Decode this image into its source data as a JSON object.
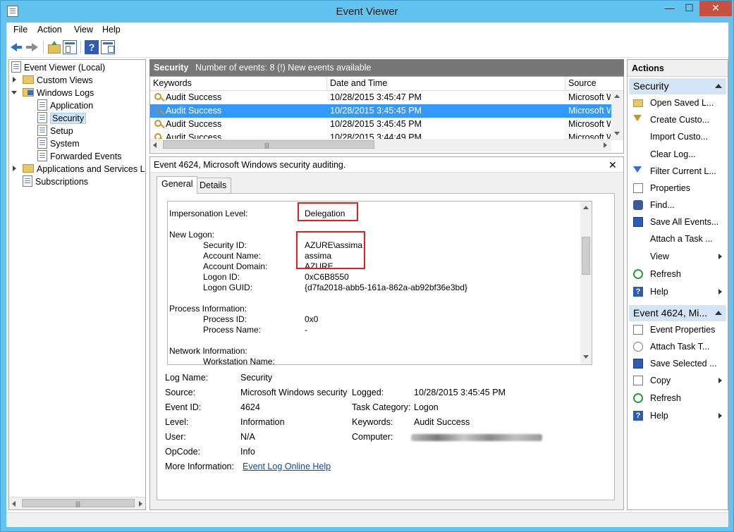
{
  "window": {
    "title": "Event Viewer"
  },
  "menu": {
    "file": "File",
    "action": "Action",
    "view": "View",
    "help": "Help"
  },
  "toolbar": {
    "help_glyph": "?"
  },
  "tree": {
    "root": "Event Viewer (Local)",
    "custom_views": "Custom Views",
    "windows_logs": "Windows Logs",
    "application": "Application",
    "security": "Security",
    "setup": "Setup",
    "system": "System",
    "forwarded_events": "Forwarded Events",
    "apps_services": "Applications and Services Lo",
    "subscriptions": "Subscriptions"
  },
  "list_header": {
    "title": "Security",
    "info": "Number of events: 8 (!) New events available"
  },
  "columns": {
    "keywords": "Keywords",
    "datetime": "Date and Time",
    "source": "Source"
  },
  "events": [
    {
      "keywords": "Audit Success",
      "datetime": "10/28/2015 3:45:47 PM",
      "source": "Microsoft W"
    },
    {
      "keywords": "Audit Success",
      "datetime": "10/28/2015 3:45:45 PM",
      "source": "Microsoft W"
    },
    {
      "keywords": "Audit Success",
      "datetime": "10/28/2015 3:45:45 PM",
      "source": "Microsoft W"
    },
    {
      "keywords": "Audit Success",
      "datetime": "10/28/2015 3:44:49 PM",
      "source": "Microsoft W"
    }
  ],
  "detail": {
    "title": "Event 4624, Microsoft Windows security auditing.",
    "close_glyph": "✕",
    "tab_general": "General",
    "tab_details": "Details",
    "message": {
      "impersonation_label": "Impersonation Level:",
      "impersonation_value": "Delegation",
      "new_logon": "New Logon:",
      "security_id_label": "Security ID:",
      "security_id_value": "AZURE\\assima",
      "account_name_label": "Account Name:",
      "account_name_value": "assima",
      "account_domain_label": "Account Domain:",
      "account_domain_value": "AZURE",
      "logon_id_label": "Logon ID:",
      "logon_id_value": "0xC6B8550",
      "logon_guid_label": "Logon GUID:",
      "logon_guid_value": "{d7fa2018-abb5-161a-862a-ab92bf36e3bd}",
      "process_info": "Process Information:",
      "process_id_label": "Process ID:",
      "process_id_value": "0x0",
      "process_name_label": "Process Name:",
      "process_name_value": "-",
      "network_info": "Network Information:",
      "workstation_label": "Workstation Name:"
    },
    "props": {
      "log_name_label": "Log Name:",
      "log_name_value": "Security",
      "source_label": "Source:",
      "source_value": "Microsoft Windows security",
      "logged_label": "Logged:",
      "logged_value": "10/28/2015 3:45:45 PM",
      "event_id_label": "Event ID:",
      "event_id_value": "4624",
      "task_category_label": "Task Category:",
      "task_category_value": "Logon",
      "level_label": "Level:",
      "level_value": "Information",
      "keywords_label": "Keywords:",
      "keywords_value": "Audit Success",
      "user_label": "User:",
      "user_value": "N/A",
      "computer_label": "Computer:",
      "opcode_label": "OpCode:",
      "opcode_value": "Info",
      "more_info_label": "More Information:",
      "more_info_link": "Event Log Online Help"
    }
  },
  "actions": {
    "header": "Actions",
    "security_section": "Security",
    "security_items": [
      "Open Saved L...",
      "Create Custo...",
      "Import Custo...",
      "Clear Log...",
      "Filter Current L...",
      "Properties",
      "Find...",
      "Save All Events...",
      "Attach a Task ...",
      "View",
      "Refresh",
      "Help"
    ],
    "event_section": "Event 4624, Mi...",
    "event_items": [
      "Event Properties",
      "Attach Task T...",
      "Save Selected ...",
      "Copy",
      "Refresh",
      "Help"
    ]
  },
  "colors": {
    "title_bar": "#62c3f0",
    "selection": "#3399ff",
    "highlight_box": "#e02020",
    "link": "#0a4ab6"
  }
}
